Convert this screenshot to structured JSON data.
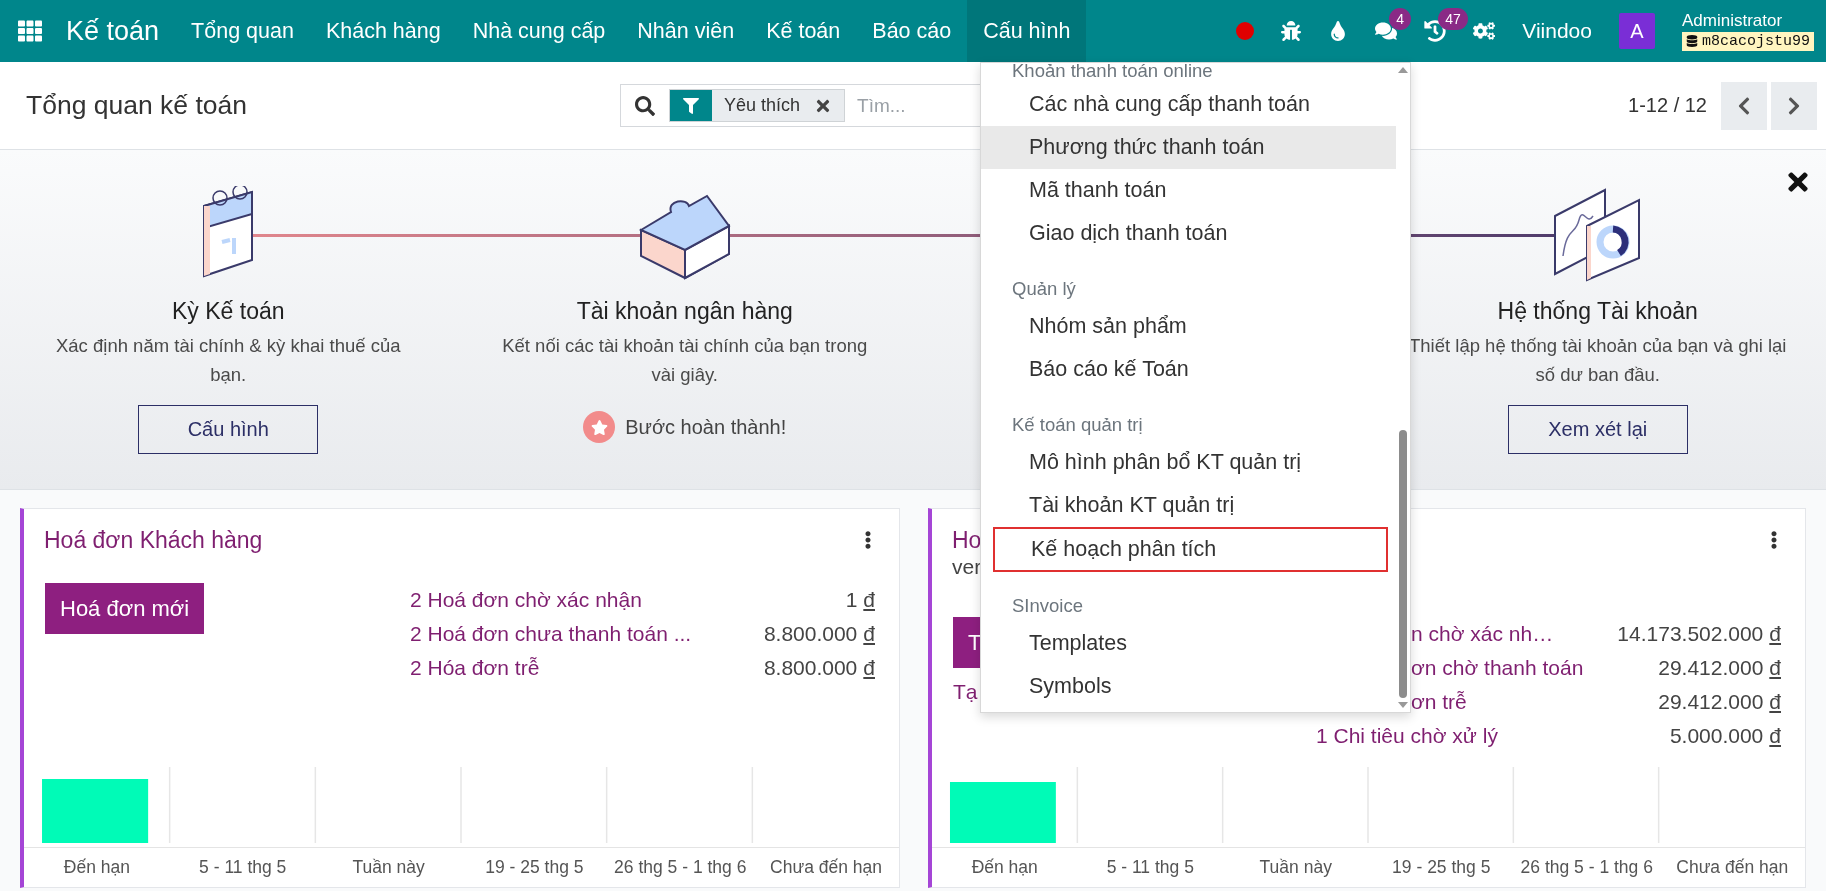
{
  "navbar": {
    "app_name": "Kế toán",
    "menu": [
      {
        "label": "Tổng quan",
        "selected": false
      },
      {
        "label": "Khách hàng",
        "selected": false
      },
      {
        "label": "Nhà cung cấp",
        "selected": false
      },
      {
        "label": "Nhân viên",
        "selected": false
      },
      {
        "label": "Kế toán",
        "selected": false
      },
      {
        "label": "Báo cáo",
        "selected": false
      },
      {
        "label": "Cấu hình",
        "selected": true
      }
    ],
    "chat_count": "4",
    "activity_count": "47",
    "company": "Viindoo",
    "avatar_letter": "A",
    "user": "Administrator",
    "database": "m8cacojstu99"
  },
  "control_panel": {
    "title": "Tổng quan kế toán",
    "facet": "Yêu thích",
    "search_placeholder": "Tìm...",
    "pager": "1-12 / 12"
  },
  "onboarding": {
    "steps": [
      {
        "title": "Kỳ Kế toán",
        "description": "Xác định năm tài chính & kỳ khai thuế của bạn.",
        "kind": "button",
        "action": "Cấu hình"
      },
      {
        "title": "Tài khoản ngân hàng",
        "description": "Kết nối các tài khoản tài chính của bạn trong vài giây.",
        "kind": "done",
        "action": "Bước hoàn thành!"
      },
      {
        "title": "Hệ thống Tài khoản",
        "description": "Thiết lập hệ thống tài khoản của bạn và ghi lại số dư ban đầu.",
        "kind": "button",
        "action": "Xem xét lại"
      }
    ]
  },
  "cards": [
    {
      "title": "Hoá đơn Khách hàng",
      "button": "Hoá đơn mới",
      "stats": [
        {
          "label": "2 Hoá đơn chờ xác nhận",
          "amount": "1",
          "currency": "đ",
          "clipped": false
        },
        {
          "label": "2 Hoá đơn chưa thanh toán ...",
          "amount": "8.800.000",
          "currency": "đ",
          "clipped": false
        },
        {
          "label": "2 Hóa đơn trễ",
          "amount": "8.800.000",
          "currency": "đ",
          "clipped": false
        }
      ],
      "chart": {
        "categories": [
          "Đến hạn",
          "5 - 11 thg 5",
          "Tuần này",
          "19 - 25 thg 5",
          "26 thg 5 - 1 thg 6",
          "Chưa đến hạn"
        ]
      }
    },
    {
      "title": "Ho",
      "subtitle": "ver",
      "button": "T",
      "link": "Tạ",
      "stats": [
        {
          "label": "n chờ xác nh…",
          "amount": "14.173.502.000",
          "currency": "đ",
          "clipped": true
        },
        {
          "label": "ơn chờ thanh toán",
          "amount": "29.412.000",
          "currency": "đ",
          "clipped": true
        },
        {
          "label": "ơn trễ",
          "amount": "29.412.000",
          "currency": "đ",
          "clipped": true
        },
        {
          "label": "1 Chi tiêu chờ xử lý",
          "amount": "5.000.000",
          "currency": "đ",
          "clipped": false
        }
      ],
      "chart": {
        "categories": [
          "Đến hạn",
          "5 - 11 thg 5",
          "Tuần này",
          "19 - 25 thg 5",
          "26 thg 5 - 1 thg 6",
          "Chưa đến hạn"
        ]
      }
    }
  ],
  "dropdown": {
    "sections": [
      {
        "header": "Khoản thanh toán online",
        "items": [
          {
            "label": "Các nhà cung cấp thanh toán",
            "selected": false,
            "outlined": false
          },
          {
            "label": "Phương thức thanh toán",
            "selected": true,
            "outlined": false
          },
          {
            "label": "Mã thanh toán",
            "selected": false,
            "outlined": false
          },
          {
            "label": "Giao dịch thanh toán",
            "selected": false,
            "outlined": false
          }
        ]
      },
      {
        "header": "Quản lý",
        "items": [
          {
            "label": "Nhóm sản phẩm",
            "selected": false,
            "outlined": false
          },
          {
            "label": "Báo cáo kế Toán",
            "selected": false,
            "outlined": false
          }
        ]
      },
      {
        "header": "Kế toán quản trị",
        "items": [
          {
            "label": "Mô hình phân bổ KT quản trị",
            "selected": false,
            "outlined": false
          },
          {
            "label": "Tài khoản KT quản trị",
            "selected": false,
            "outlined": false
          },
          {
            "label": "Kế hoạch phân tích",
            "selected": false,
            "outlined": true
          }
        ]
      },
      {
        "header": "SInvoice",
        "items": [
          {
            "label": "Templates",
            "selected": false,
            "outlined": false
          },
          {
            "label": "Symbols",
            "selected": false,
            "outlined": false
          }
        ]
      }
    ]
  }
}
